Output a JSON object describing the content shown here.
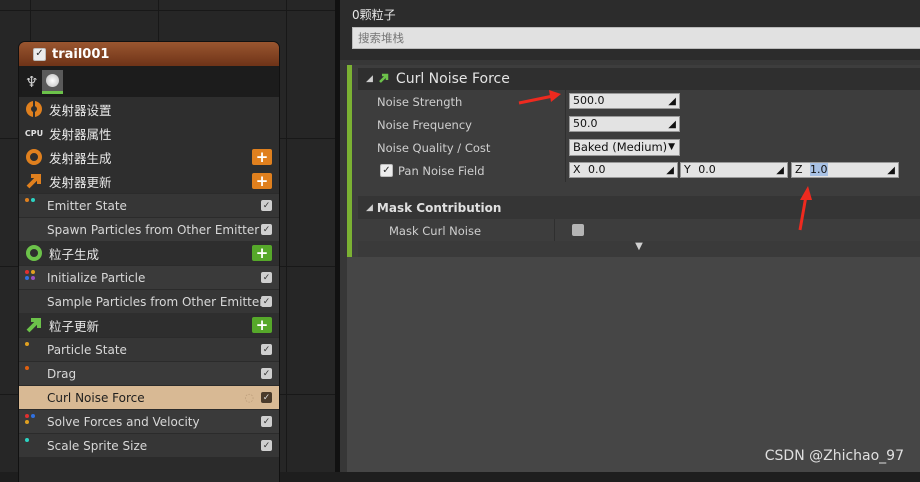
{
  "emitter_node": {
    "title": "trail001",
    "title_checked": true,
    "stages": [
      {
        "kind": "stage",
        "label": "发射器设置",
        "icon": "gear-icon",
        "color": "#e0801e"
      },
      {
        "kind": "stage",
        "label": "发射器属性",
        "icon": "cpu-icon",
        "color": "#cfcfcf"
      },
      {
        "kind": "stage",
        "label": "发射器生成",
        "icon": "ring-icon",
        "color": "#e0801e",
        "button": "+"
      },
      {
        "kind": "stage",
        "label": "发射器更新",
        "icon": "arrow-up-right-icon",
        "color": "#e0801e",
        "button": "+"
      },
      {
        "kind": "module",
        "label": "Emitter State",
        "checked": true
      },
      {
        "kind": "module",
        "label": "Spawn Particles from Other Emitter",
        "checked": true
      },
      {
        "kind": "stage",
        "label": "粒子生成",
        "icon": "ring-icon",
        "color": "#6cc24a",
        "button": "+"
      },
      {
        "kind": "module",
        "label": "Initialize Particle",
        "checked": true
      },
      {
        "kind": "module",
        "label": "Sample Particles from Other Emitter",
        "checked": true
      },
      {
        "kind": "stage",
        "label": "粒子更新",
        "icon": "arrow-up-right-icon",
        "color": "#6cc24a",
        "button": "+"
      },
      {
        "kind": "module",
        "label": "Particle State",
        "checked": true
      },
      {
        "kind": "module",
        "label": "Drag",
        "checked": true
      },
      {
        "kind": "module",
        "label": "Curl Noise Force",
        "checked": true,
        "selected": true
      },
      {
        "kind": "module",
        "label": "Solve Forces and Velocity",
        "checked": true
      },
      {
        "kind": "module",
        "label": "Scale Sprite Size",
        "checked": true
      }
    ]
  },
  "details": {
    "particle_count": "0颗粒子",
    "search_placeholder": "搜索堆栈",
    "section_title": "Curl Noise Force",
    "props": {
      "noise_strength": {
        "label": "Noise Strength",
        "value": "500.0"
      },
      "noise_frequency": {
        "label": "Noise Frequency",
        "value": "50.0"
      },
      "noise_quality": {
        "label": "Noise Quality / Cost",
        "value": "Baked (Medium)"
      },
      "pan_noise_field": {
        "label": "Pan Noise Field",
        "checked": true,
        "x_label": "X",
        "x": "0.0",
        "y_label": "Y",
        "y": "0.0",
        "z_label": "Z",
        "z": "1.0"
      }
    },
    "mask": {
      "title": "Mask Contribution",
      "label": "Mask Curl Noise",
      "checked": false
    }
  },
  "watermark": "CSDN @Zhichao_97",
  "colors": {
    "accent_green": "#7bb133",
    "accent_orange": "#e0801e",
    "arrow_red": "#ee2a1f",
    "selected_row": "#d8b994"
  }
}
